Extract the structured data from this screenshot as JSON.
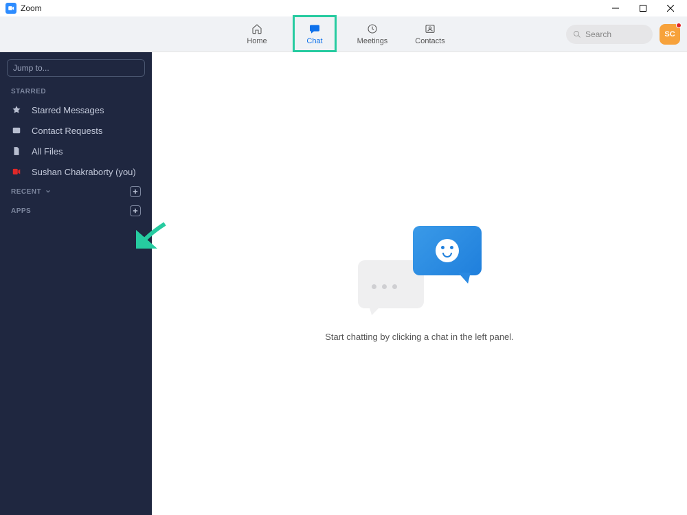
{
  "window": {
    "title": "Zoom"
  },
  "nav": {
    "items": [
      {
        "label": "Home"
      },
      {
        "label": "Chat"
      },
      {
        "label": "Meetings"
      },
      {
        "label": "Contacts"
      }
    ],
    "search_placeholder": "Search",
    "avatar_initials": "SC"
  },
  "sidebar": {
    "jump_placeholder": "Jump to...",
    "sections": {
      "starred": {
        "label": "STARRED",
        "items": [
          {
            "label": "Starred Messages"
          },
          {
            "label": "Contact Requests"
          },
          {
            "label": "All Files"
          },
          {
            "label": "Sushan Chakraborty (you)"
          }
        ]
      },
      "recent": {
        "label": "RECENT"
      },
      "apps": {
        "label": "APPS"
      }
    }
  },
  "main": {
    "empty_text": "Start chatting by clicking a chat in the left panel."
  },
  "colors": {
    "accent": "#0e71eb",
    "highlight": "#26cba0",
    "sidebar_bg": "#1f2740"
  }
}
